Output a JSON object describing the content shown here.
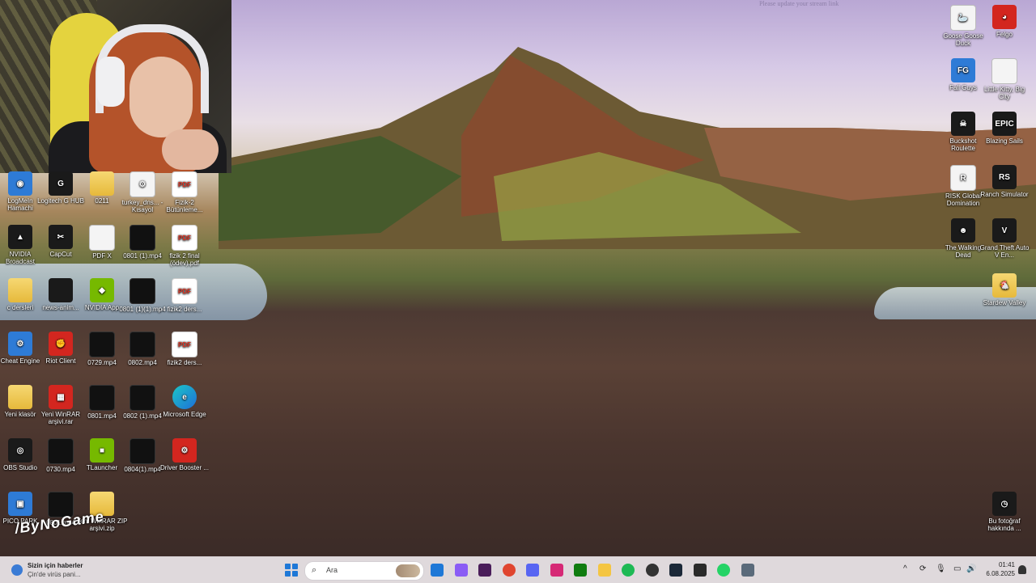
{
  "wallpaper": {
    "watermark": "Please update your stream link"
  },
  "overlay": {
    "text": "/ByNoGame"
  },
  "desktop_left": [
    {
      "label": "LogMeIn Hamachi",
      "kind": "blue",
      "glyph": "◉"
    },
    {
      "label": "Logitech G HUB",
      "kind": "dark",
      "glyph": "G"
    },
    {
      "label": "0211",
      "kind": "folder",
      "glyph": ""
    },
    {
      "label": "turkey_dns... - Kısayol",
      "kind": "file",
      "glyph": "⚙"
    },
    {
      "label": "Fizik-2 Bütünleme...",
      "kind": "pdf",
      "glyph": "PDF"
    },
    {
      "label": "NVIDIA Broadcast",
      "kind": "dark",
      "glyph": "▲"
    },
    {
      "label": "CapCut",
      "kind": "dark",
      "glyph": "✂"
    },
    {
      "label": "PDF X",
      "kind": "file",
      "glyph": ""
    },
    {
      "label": "0801 (1).mp4",
      "kind": "video",
      "glyph": ""
    },
    {
      "label": "fizik 2 final (ödev).pdf",
      "kind": "pdf",
      "glyph": "PDF"
    },
    {
      "label": "c dersleri",
      "kind": "folder",
      "glyph": ""
    },
    {
      "label": "news-anim...",
      "kind": "dark",
      "glyph": ""
    },
    {
      "label": "NVIDIA App",
      "kind": "green",
      "glyph": "◆"
    },
    {
      "label": "0801 (1)(1).mp4",
      "kind": "video",
      "glyph": ""
    },
    {
      "label": "fizik2 ders...",
      "kind": "pdf",
      "glyph": "PDF"
    },
    {
      "label": "Cheat Engine",
      "kind": "blue",
      "glyph": "⚙"
    },
    {
      "label": "Riot Client",
      "kind": "red",
      "glyph": "✊"
    },
    {
      "label": "0729.mp4",
      "kind": "video",
      "glyph": ""
    },
    {
      "label": "0802.mp4",
      "kind": "video",
      "glyph": ""
    },
    {
      "label": "fizik2 ders...",
      "kind": "pdf",
      "glyph": "PDF"
    },
    {
      "label": "Yeni klasör",
      "kind": "folder",
      "glyph": ""
    },
    {
      "label": "Yeni WinRAR arşivi.rar",
      "kind": "red",
      "glyph": "▦"
    },
    {
      "label": "0801.mp4",
      "kind": "video",
      "glyph": ""
    },
    {
      "label": "0802 (1).mp4",
      "kind": "video",
      "glyph": ""
    },
    {
      "label": "Microsoft Edge",
      "kind": "edge",
      "glyph": "e"
    },
    {
      "label": "OBS Studio",
      "kind": "dark",
      "glyph": "◎"
    },
    {
      "label": "0730.mp4",
      "kind": "video",
      "glyph": ""
    },
    {
      "label": "TLauncher",
      "kind": "green",
      "glyph": "■"
    },
    {
      "label": "0804(1).mp4",
      "kind": "video",
      "glyph": ""
    },
    {
      "label": "Driver Booster ...",
      "kind": "red",
      "glyph": "⚙"
    },
    {
      "label": "PICO PARK",
      "kind": "blue",
      "glyph": "▣"
    },
    {
      "label": "0801.mp4",
      "kind": "video",
      "glyph": ""
    },
    {
      "label": "Yeni WinRAR ZIP arşivi.zip",
      "kind": "folder",
      "glyph": ""
    }
  ],
  "desktop_right": [
    {
      "label": "Goose Goose Duck",
      "kind": "file",
      "glyph": "🦢"
    },
    {
      "label": "Felgo",
      "kind": "red",
      "glyph": "◕"
    },
    {
      "label": "Fall Guys",
      "kind": "blue",
      "glyph": "FG"
    },
    {
      "label": "Little Kitty, Big City",
      "kind": "file",
      "glyph": ""
    },
    {
      "label": "Buckshot Roulette",
      "kind": "dark",
      "glyph": "☠"
    },
    {
      "label": "Blazing Sails",
      "kind": "dark",
      "glyph": "EPIC"
    },
    {
      "label": "RISK Global Domination",
      "kind": "file",
      "glyph": "R"
    },
    {
      "label": "Ranch Simulator",
      "kind": "dark",
      "glyph": "RS"
    },
    {
      "label": "The Walking Dead",
      "kind": "dark",
      "glyph": "☻"
    },
    {
      "label": "Grand Theft Auto V En...",
      "kind": "dark",
      "glyph": "V"
    },
    {
      "label": "Stardew Valley",
      "kind": "folder",
      "glyph": "🐔"
    },
    {
      "label": "Bu fotoğraf hakkında ...",
      "kind": "dark",
      "glyph": "◷"
    }
  ],
  "taskbar": {
    "news_title": "Sizin için haberler",
    "news_sub": "Çin'de virüs pani...",
    "search_placeholder": "Ara",
    "apps": [
      "edge-icon",
      "copilot-icon",
      "purple-app-icon",
      "chrome-icon",
      "discord-icon",
      "instagram-icon",
      "xbox-icon",
      "explorer-icon",
      "spotify-icon",
      "obs-icon",
      "steam-icon",
      "epic-icon",
      "whatsapp-icon",
      "network-game-icon"
    ],
    "time": "01:41",
    "date": "6.08.2025"
  }
}
